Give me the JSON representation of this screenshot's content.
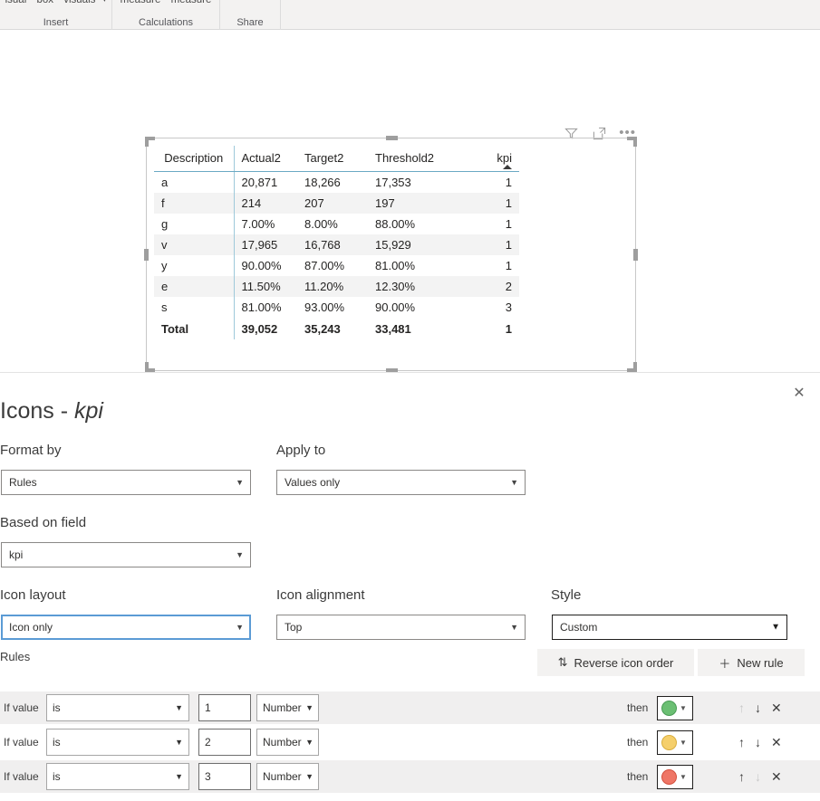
{
  "ribbon": {
    "groups": [
      {
        "items": [
          "isual",
          "box",
          "visuals"
        ],
        "has_chevron": true,
        "label": "Insert"
      },
      {
        "items": [
          "measure",
          "measure"
        ],
        "has_chevron": false,
        "label": "Calculations"
      },
      {
        "items": [],
        "has_chevron": false,
        "label": "Share"
      }
    ]
  },
  "visual_header": {
    "filter_icon": "filter-icon",
    "focus_icon": "focus-mode-icon",
    "more_options": "•••"
  },
  "table": {
    "columns": [
      "Description",
      "Actual2",
      "Target2",
      "Threshold2",
      "kpi"
    ],
    "sorted_column": "kpi",
    "sort_direction": "ascending",
    "rows": [
      {
        "cells": [
          "a",
          "20,871",
          "18,266",
          "17,353",
          "1"
        ]
      },
      {
        "cells": [
          "f",
          "214",
          "207",
          "197",
          "1"
        ]
      },
      {
        "cells": [
          "g",
          "7.00%",
          "8.00%",
          "88.00%",
          "1"
        ]
      },
      {
        "cells": [
          "v",
          "17,965",
          "16,768",
          "15,929",
          "1"
        ]
      },
      {
        "cells": [
          "y",
          "90.00%",
          "87.00%",
          "81.00%",
          "1"
        ]
      },
      {
        "cells": [
          "e",
          "11.50%",
          "11.20%",
          "12.30%",
          "2"
        ]
      },
      {
        "cells": [
          "s",
          "81.00%",
          "93.00%",
          "90.00%",
          "3"
        ]
      }
    ],
    "total_row": {
      "cells": [
        "Total",
        "39,052",
        "35,243",
        "33,481",
        "1"
      ]
    }
  },
  "pane": {
    "close_label": "✕",
    "title_prefix": "Icons - ",
    "title_field": "kpi",
    "format_by": {
      "label": "Format by",
      "value": "Rules"
    },
    "apply_to": {
      "label": "Apply to",
      "value": "Values only"
    },
    "based_on_field": {
      "label": "Based on field",
      "value": "kpi"
    },
    "icon_layout": {
      "label": "Icon layout",
      "value": "Icon only"
    },
    "icon_alignment": {
      "label": "Icon alignment",
      "value": "Top"
    },
    "style": {
      "label": "Style",
      "value": "Custom"
    },
    "rules_label": "Rules",
    "reverse_icon_order": {
      "label": "Reverse icon order",
      "glyph": "⇅"
    },
    "new_rule": {
      "label": "New rule",
      "glyph": "＋"
    },
    "rules": [
      {
        "if_value_label": "If value",
        "condition": "is",
        "value": "1",
        "unit": "Number",
        "then_label": "then",
        "icon_color": "#6bbf73",
        "icon_border": "#4a9b55",
        "shaded": true,
        "up_enabled": false,
        "down_enabled": true
      },
      {
        "if_value_label": "If value",
        "condition": "is",
        "value": "2",
        "unit": "Number",
        "then_label": "then",
        "icon_color": "#f5cf6b",
        "icon_border": "#d9ae3f",
        "shaded": false,
        "up_enabled": true,
        "down_enabled": true
      },
      {
        "if_value_label": "If value",
        "condition": "is",
        "value": "3",
        "unit": "Number",
        "then_label": "then",
        "icon_color": "#ef7666",
        "icon_border": "#d4503e",
        "shaded": true,
        "up_enabled": true,
        "down_enabled": false
      }
    ],
    "arrow_up": "↑",
    "arrow_down": "↓",
    "remove": "✕"
  },
  "colors": {
    "ribbon_bg": "#f3f2f1",
    "table_header_rule": "#6aa9c4",
    "alt_row": "#f3f3f3",
    "focus_border": "#5b9bd5"
  }
}
